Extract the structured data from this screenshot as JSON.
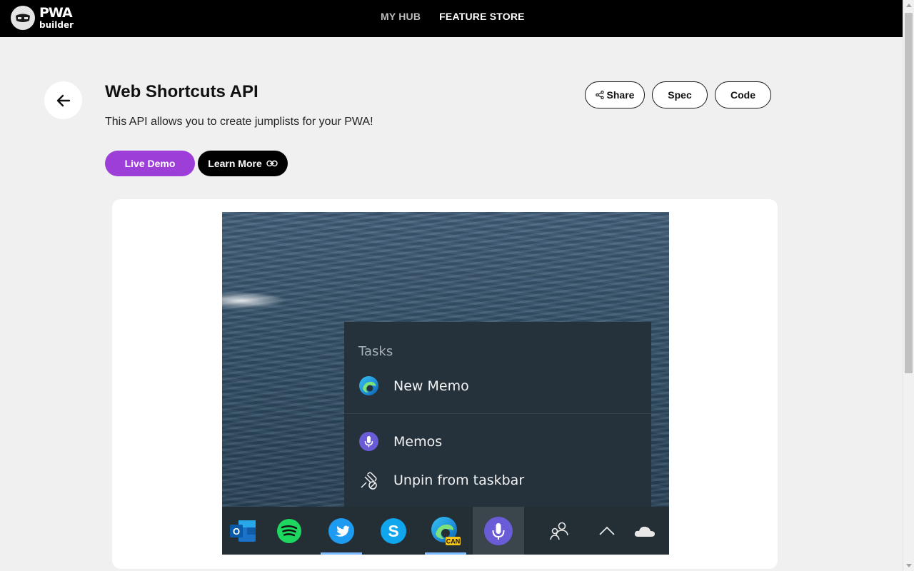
{
  "header": {
    "logo_main": "PWA",
    "logo_sub": "builder",
    "nav": [
      {
        "label": "MY HUB"
      },
      {
        "label": "FEATURE STORE"
      }
    ]
  },
  "feature": {
    "title": "Web Shortcuts API",
    "description": "This API allows you to create jumplists for your PWA!",
    "live_demo_label": "Live Demo",
    "learn_more_label": "Learn More",
    "share_label": "Share",
    "spec_label": "Spec",
    "code_label": "Code"
  },
  "demo_image": {
    "jumplist_heading": "Tasks",
    "items": [
      {
        "label": "New Memo",
        "icon": "edge-icon"
      },
      {
        "label": "Memos",
        "icon": "microphone-app-icon"
      },
      {
        "label": "Unpin from taskbar",
        "icon": "unpin-icon"
      }
    ],
    "taskbar_apps": [
      {
        "icon": "outlook-icon"
      },
      {
        "icon": "spotify-icon"
      },
      {
        "icon": "twitter-icon"
      },
      {
        "icon": "skype-icon"
      },
      {
        "icon": "edge-canary-icon",
        "badge": "CAN"
      },
      {
        "icon": "memos-app-icon"
      },
      {
        "icon": "people-icon"
      },
      {
        "icon": "chevron-up-icon"
      },
      {
        "icon": "onedrive-icon"
      }
    ]
  },
  "colors": {
    "accent": "#9d3ed8",
    "header_bg": "#000000",
    "page_bg": "#f0f0f0"
  }
}
